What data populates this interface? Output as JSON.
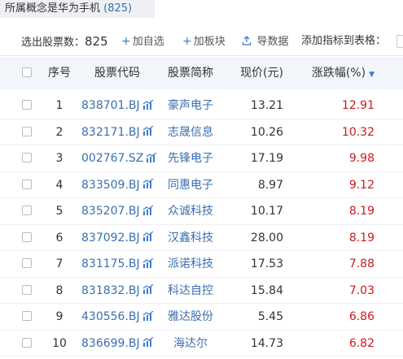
{
  "concept": {
    "label": "所属概念是华为手机",
    "count": "(825)"
  },
  "toolbar": {
    "selected_label": "选出股票数：",
    "selected_count": "825",
    "add_favorite": "加自选",
    "add_board": "加板块",
    "export": "导数据",
    "add_indicator": "添加指标到表格："
  },
  "table": {
    "headers": {
      "seq": "序号",
      "code": "股票代码",
      "name": "股票简称",
      "price": "现价(元)",
      "change": "涨跌幅(%)"
    },
    "sort_indicator": "▼",
    "rows": [
      {
        "seq": "1",
        "code": "838701.BJ",
        "name": "豪声电子",
        "price": "13.21",
        "change": "12.91"
      },
      {
        "seq": "2",
        "code": "832171.BJ",
        "name": "志晟信息",
        "price": "10.26",
        "change": "10.32"
      },
      {
        "seq": "3",
        "code": "002767.SZ",
        "name": "先锋电子",
        "price": "17.19",
        "change": "9.98"
      },
      {
        "seq": "4",
        "code": "833509.BJ",
        "name": "同惠电子",
        "price": "8.97",
        "change": "9.12"
      },
      {
        "seq": "5",
        "code": "835207.BJ",
        "name": "众诚科技",
        "price": "10.17",
        "change": "8.19"
      },
      {
        "seq": "6",
        "code": "837092.BJ",
        "name": "汉鑫科技",
        "price": "28.00",
        "change": "8.19"
      },
      {
        "seq": "7",
        "code": "831175.BJ",
        "name": "派诺科技",
        "price": "17.53",
        "change": "7.88"
      },
      {
        "seq": "8",
        "code": "831832.BJ",
        "name": "科达自控",
        "price": "15.84",
        "change": "7.03"
      },
      {
        "seq": "9",
        "code": "430556.BJ",
        "name": "雅达股份",
        "price": "5.45",
        "change": "6.86"
      },
      {
        "seq": "10",
        "code": "836699.BJ",
        "name": "海达尔",
        "price": "14.73",
        "change": "6.82"
      }
    ]
  },
  "colors": {
    "link": "#3a6fb0",
    "accent": "#3a7bd5",
    "rise": "#d0171b",
    "header_bg": "#f2f5f9"
  },
  "icons": {
    "add": "plus-icon",
    "export": "upload-icon",
    "trend": "trend-chart-icon",
    "sort": "sort-desc-icon"
  }
}
